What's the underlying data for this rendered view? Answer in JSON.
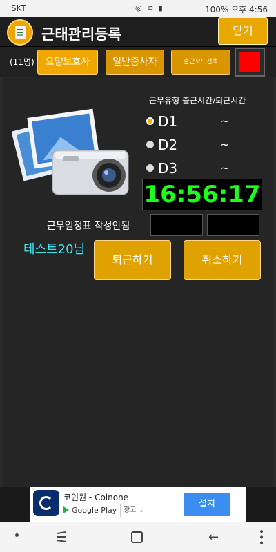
{
  "status_bar": {
    "carrier": "SKT",
    "battery": "100%",
    "time": "오후 4:56"
  },
  "header": {
    "title": "근태관리등록",
    "close_label": "닫기"
  },
  "toolbar": {
    "count": "(11명)",
    "tab1": "요양보호사",
    "tab2": "일반종사자",
    "mode_label": "출근모드선택",
    "mode_color": "#ff0000"
  },
  "main": {
    "column_header": "근무유형  출근시간/퇴근시간",
    "shifts": [
      {
        "label": "D1",
        "selected": true,
        "range": "~"
      },
      {
        "label": "D2",
        "selected": false,
        "range": "~"
      },
      {
        "label": "D3",
        "selected": false,
        "range": "~"
      }
    ],
    "clock": "16:56:17",
    "schedule_label": "근무일정표 작성안됨",
    "user_name": "테스트20님",
    "leave_label": "퇴근하기",
    "cancel_label": "취소하기"
  },
  "ad": {
    "name": "코인원 - Coinone",
    "store": "Google Play",
    "ad_tag": "광고",
    "install_label": "설치"
  }
}
